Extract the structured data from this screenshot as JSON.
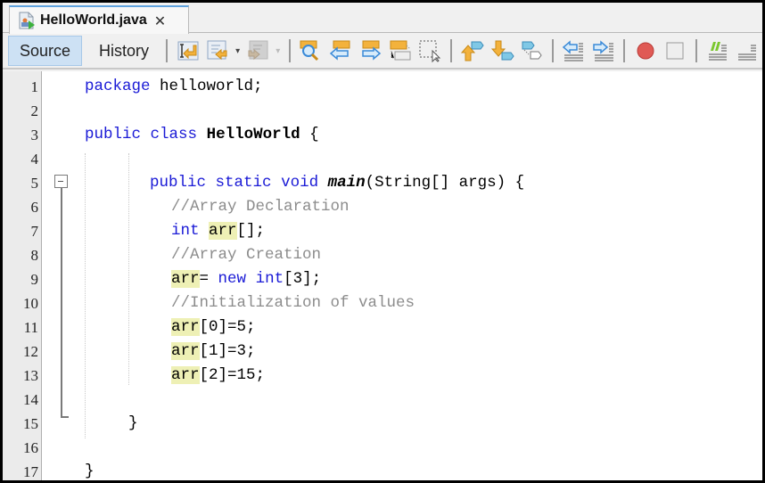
{
  "tab": {
    "title": "HelloWorld.java",
    "close_glyph": "✕",
    "icon": "java-file-icon"
  },
  "toolbar": {
    "source_label": "Source",
    "history_label": "History",
    "active": "Source",
    "icons": [
      "last-edit-icon",
      "back-icon",
      "forward-icon",
      "find-selection-icon",
      "find-previous-icon",
      "find-next-icon",
      "toggle-highlight-icon",
      "toggle-rectangular-selection-icon",
      "previous-bookmark-icon",
      "next-bookmark-icon",
      "toggle-bookmark-icon",
      "shift-left-icon",
      "shift-right-icon",
      "start-macro-icon",
      "stop-macro-icon",
      "comment-icon",
      "uncomment-icon"
    ],
    "dropdown_glyph": "▾"
  },
  "colors": {
    "keyword": "#1a1ad6",
    "comment": "#8c8c8c",
    "highlight": "#eef0b5",
    "tab_accent": "#5fa2dd",
    "active_button": "#cde1f4",
    "record": "#e05a55"
  },
  "editor": {
    "lines": [
      {
        "n": "1",
        "tokens": [
          {
            "t": "package",
            "c": "kw"
          },
          {
            "t": " helloworld;",
            "c": ""
          }
        ]
      },
      {
        "n": "2",
        "tokens": []
      },
      {
        "n": "3",
        "tokens": [
          {
            "t": "public",
            "c": "kw"
          },
          {
            "t": " ",
            "c": ""
          },
          {
            "t": "class",
            "c": "kw"
          },
          {
            "t": " ",
            "c": ""
          },
          {
            "t": "HelloWorld",
            "c": "cls"
          },
          {
            "t": " {",
            "c": ""
          }
        ]
      },
      {
        "n": "4",
        "tokens": []
      },
      {
        "n": "5",
        "tokens": [
          {
            "t": "public",
            "c": "kw"
          },
          {
            "t": " ",
            "c": ""
          },
          {
            "t": "static",
            "c": "kw"
          },
          {
            "t": " ",
            "c": ""
          },
          {
            "t": "void",
            "c": "kw"
          },
          {
            "t": " ",
            "c": ""
          },
          {
            "t": "main",
            "c": "mth"
          },
          {
            "t": "(String[] args) {",
            "c": ""
          }
        ]
      },
      {
        "n": "6",
        "tokens": [
          {
            "t": "//Array Declaration",
            "c": "cm"
          }
        ]
      },
      {
        "n": "7",
        "tokens": [
          {
            "t": "int",
            "c": "kw"
          },
          {
            "t": " ",
            "c": ""
          },
          {
            "t": "arr",
            "c": "hl"
          },
          {
            "t": "[];",
            "c": ""
          }
        ]
      },
      {
        "n": "8",
        "tokens": [
          {
            "t": "//Array Creation",
            "c": "cm"
          }
        ]
      },
      {
        "n": "9",
        "tokens": [
          {
            "t": "arr",
            "c": "hl"
          },
          {
            "t": "= ",
            "c": ""
          },
          {
            "t": "new",
            "c": "kw"
          },
          {
            "t": " ",
            "c": ""
          },
          {
            "t": "int",
            "c": "kw"
          },
          {
            "t": "[3];",
            "c": ""
          }
        ]
      },
      {
        "n": "10",
        "tokens": [
          {
            "t": "//Initialization of values",
            "c": "cm"
          }
        ]
      },
      {
        "n": "11",
        "tokens": [
          {
            "t": "arr",
            "c": "hl"
          },
          {
            "t": "[0]=5;",
            "c": ""
          }
        ]
      },
      {
        "n": "12",
        "tokens": [
          {
            "t": "arr",
            "c": "hl"
          },
          {
            "t": "[1]=3;",
            "c": ""
          }
        ]
      },
      {
        "n": "13",
        "tokens": [
          {
            "t": "arr",
            "c": "hl"
          },
          {
            "t": "[2]=15;",
            "c": ""
          }
        ]
      },
      {
        "n": "14",
        "tokens": []
      },
      {
        "n": "15",
        "tokens": [
          {
            "t": "}",
            "c": ""
          }
        ]
      },
      {
        "n": "16",
        "tokens": []
      },
      {
        "n": "17",
        "tokens": [
          {
            "t": "}",
            "c": ""
          }
        ]
      }
    ]
  }
}
